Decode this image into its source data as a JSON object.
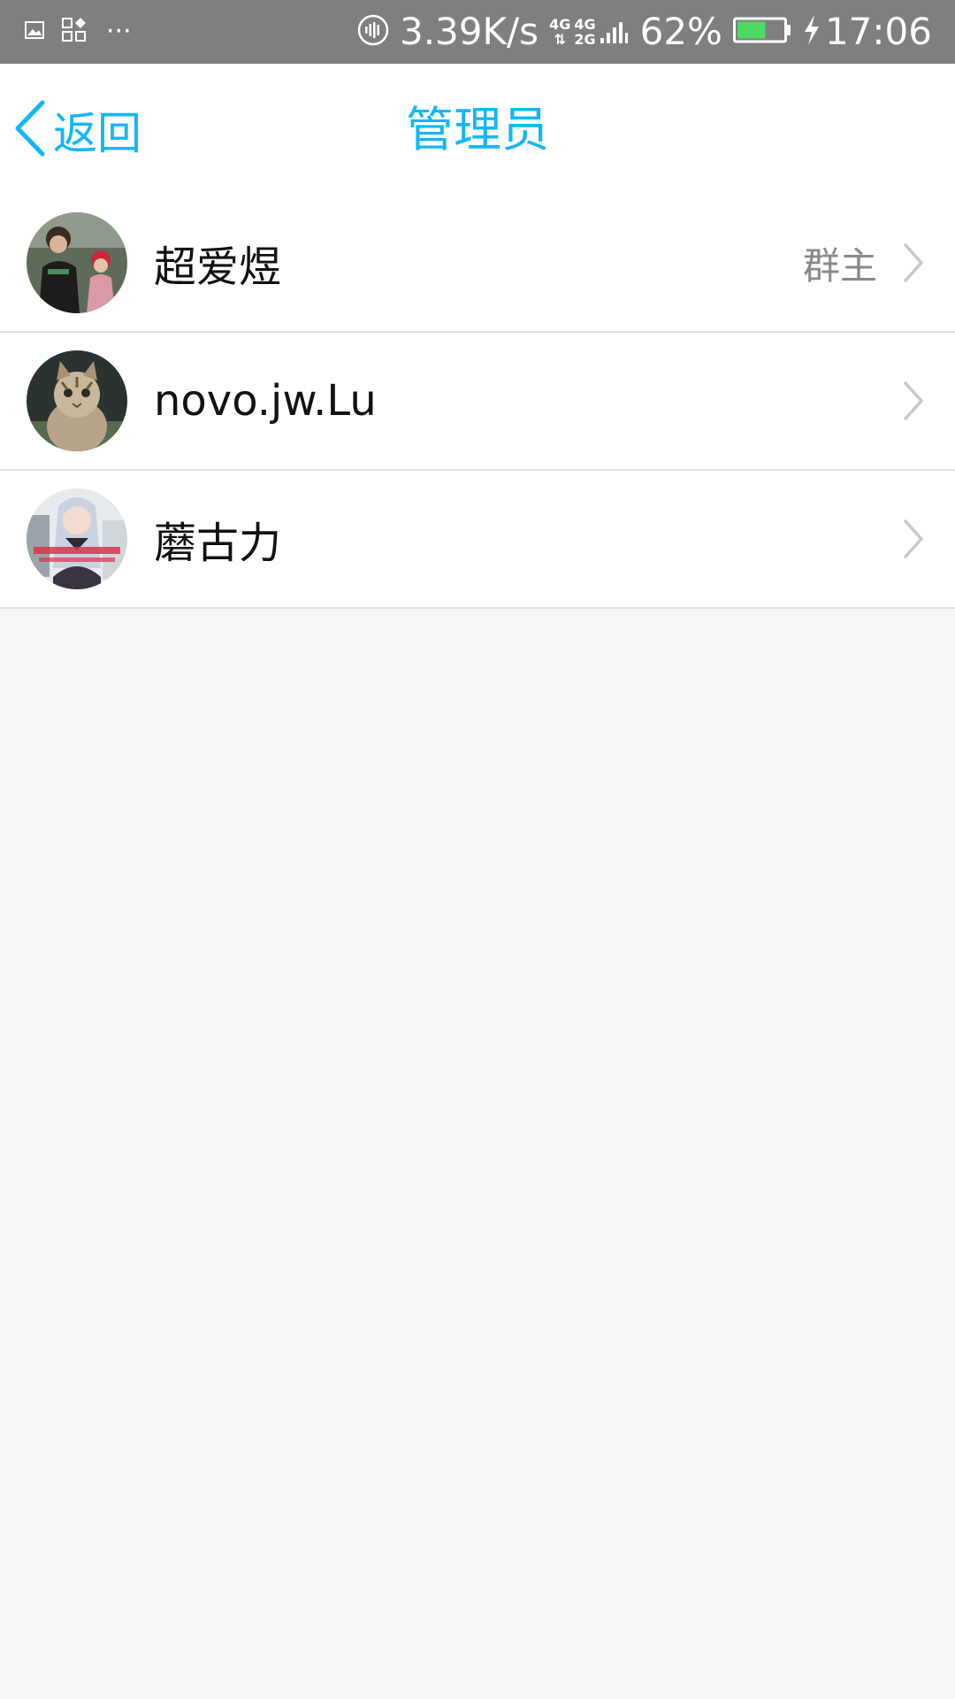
{
  "status_bar": {
    "network_speed": "3.39K/s",
    "net_top_1": "4G",
    "net_bottom_1": "⇅",
    "net_top_2": "4G",
    "net_bottom_2": "2G",
    "battery_percent": "62%",
    "battery_level": 0.62,
    "time": "17:06",
    "more": "···"
  },
  "nav": {
    "back_label": "返回",
    "title": "管理员"
  },
  "members": [
    {
      "name": "超爱煜",
      "role": "群主"
    },
    {
      "name": "novo.jw.Lu",
      "role": ""
    },
    {
      "name": "蘑古力",
      "role": ""
    }
  ],
  "colors": {
    "accent": "#12b7f5",
    "status_bar_bg": "#7f7f7f",
    "battery_fill": "#4cd964",
    "page_bg": "#f7f7f9"
  }
}
